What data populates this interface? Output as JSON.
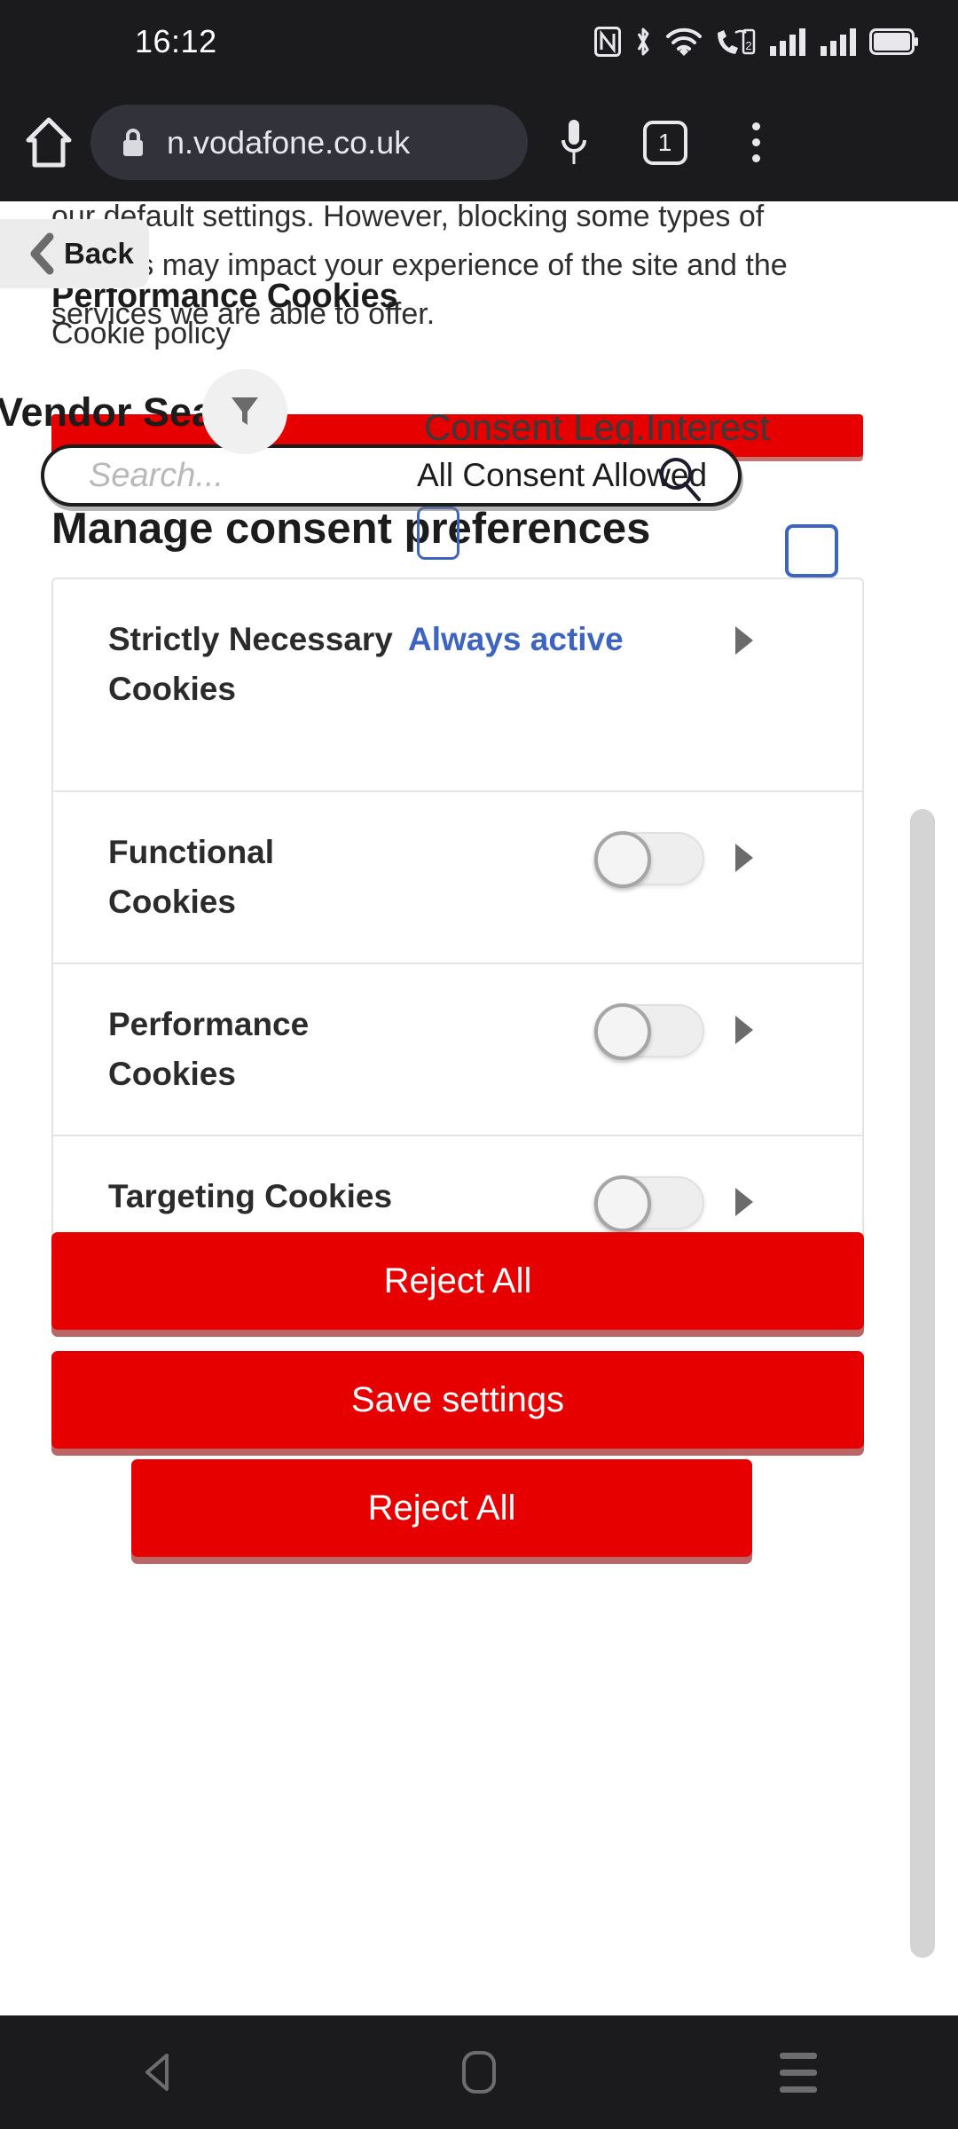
{
  "status_bar": {
    "time": "16:12",
    "icons": [
      "nfc-icon",
      "bluetooth-icon",
      "wifi-icon",
      "call-wifi-icon",
      "signal-sim1-icon",
      "signal-sim2-icon",
      "battery-icon"
    ]
  },
  "browser": {
    "url": "n.vodafone.co.uk",
    "tab_count": "1",
    "home_icon": "home-icon",
    "lock_icon": "lock-icon",
    "mic_icon": "microphone-icon",
    "menu_icon": "overflow-menu-icon"
  },
  "overlay": {
    "back_label": "Back",
    "back_icon": "chevron-left-icon"
  },
  "intro": {
    "paragraph": "our default settings. However, blocking some types of cookies may impact your experience of the site and the services we are able to offer.",
    "ghost_heading": "Performance Cookies",
    "cookie_policy_link": "Cookie policy"
  },
  "vendor_search": {
    "heading": "Vendor Search",
    "filter_icon": "filter-funnel-icon",
    "consent_bar_label": "Consent Leg.Interest",
    "search_placeholder": "Search...",
    "consent_status": "All Consent Allowed",
    "search_icon": "search-magnifier-icon"
  },
  "main": {
    "title": "Manage consent preferences"
  },
  "cookie_categories": [
    {
      "name": "Strictly Necessary Cookies",
      "state_label": "Always active",
      "has_toggle": false,
      "toggle_on": false,
      "arrow_icon": "triangle-right-icon"
    },
    {
      "name": "Functional Cookies",
      "state_label": "",
      "has_toggle": true,
      "toggle_on": false,
      "arrow_icon": "triangle-right-icon"
    },
    {
      "name": "Performance Cookies",
      "state_label": "",
      "has_toggle": true,
      "toggle_on": false,
      "arrow_icon": "triangle-right-icon"
    },
    {
      "name": "Targeting Cookies",
      "state_label": "",
      "has_toggle": true,
      "toggle_on": false,
      "arrow_icon": "triangle-right-icon"
    }
  ],
  "actions": {
    "reject_all_top": "Reject All",
    "save_settings": "Save settings",
    "reject_all_bottom": "Reject All"
  },
  "nav_bar": {
    "back": "nav-back-icon",
    "home": "nav-home-icon",
    "recents": "nav-recents-icon"
  },
  "colors": {
    "brand_red": "#E60000",
    "link_blue": "#3C64C0",
    "chrome_dark": "#1B1B1E",
    "omnibox": "#32323A"
  }
}
